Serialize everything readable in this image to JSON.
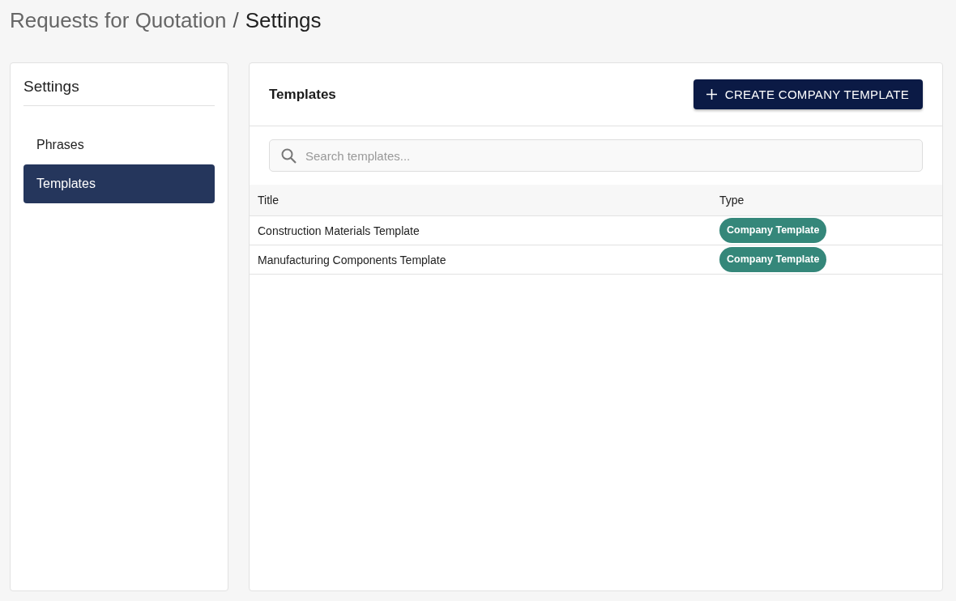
{
  "breadcrumb": {
    "separator": "/",
    "items": [
      {
        "label": "Requests for Quotation",
        "current": false
      },
      {
        "label": "Settings",
        "current": true
      }
    ]
  },
  "sidebar": {
    "title": "Settings",
    "items": [
      {
        "label": "Phrases",
        "selected": false
      },
      {
        "label": "Templates",
        "selected": true
      }
    ]
  },
  "panel": {
    "title": "Templates",
    "create_button": "CREATE COMPANY TEMPLATE",
    "search": {
      "placeholder": "Search templates..."
    },
    "table": {
      "columns": [
        "Title",
        "Type"
      ],
      "rows": [
        {
          "title": "Construction Materials Template",
          "type": "Company Template"
        },
        {
          "title": "Manufacturing Components Template",
          "type": "Company Template"
        }
      ]
    }
  }
}
